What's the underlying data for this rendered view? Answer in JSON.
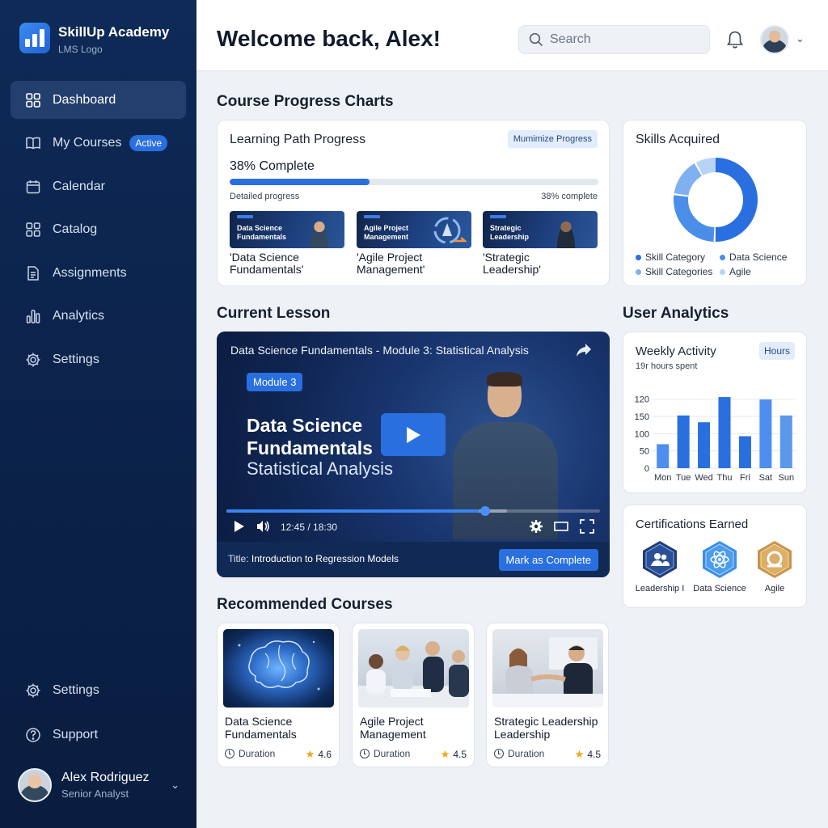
{
  "brand": {
    "title": "SkillUp Academy",
    "subtitle": "LMS Logo"
  },
  "sidebar": {
    "items": [
      {
        "label": "Dashboard",
        "icon": "grid-icon",
        "active": true
      },
      {
        "label": "My Courses",
        "icon": "book-icon",
        "badge": "Active"
      },
      {
        "label": "Calendar",
        "icon": "calendar-icon"
      },
      {
        "label": "Catalog",
        "icon": "grid-icon"
      },
      {
        "label": "Assignments",
        "icon": "document-icon"
      },
      {
        "label": "Analytics",
        "icon": "bar-chart-icon"
      },
      {
        "label": "Settings",
        "icon": "gear-icon"
      }
    ],
    "bottom": [
      {
        "label": "Settings",
        "icon": "gear-icon"
      },
      {
        "label": "Support",
        "icon": "help-icon"
      }
    ],
    "user": {
      "name": "Alex Rodriguez",
      "role": "Senior Analyst"
    }
  },
  "header": {
    "welcome": "Welcome back, Alex!",
    "search_placeholder": "Search"
  },
  "sections": {
    "progress": "Course Progress Charts",
    "lesson": "Current Lesson",
    "analytics": "User Analytics",
    "recommended": "Recommended Courses"
  },
  "learning_path": {
    "title": "Learning Path Progress",
    "button": "Mumimize Progress",
    "percent_label": "38% Complete",
    "progress": 0.38,
    "detail_left": "Detailed progress",
    "detail_right": "38% complete",
    "courses": [
      {
        "thumb": "Data Science Fundamentals",
        "caption": "'Data Science Fundamentals'"
      },
      {
        "thumb": "Agile Project Management",
        "caption": "'Agile Project Management'"
      },
      {
        "thumb": "Strategic Leadership",
        "caption": "'Strategic Leadership'"
      }
    ]
  },
  "skills": {
    "title": "Skills Acquired",
    "legend": [
      "Skill Category",
      "Data Science",
      "Skill Categories",
      "Agile"
    ],
    "colors": [
      "#2a6fe0",
      "#4a8ee8",
      "#7fb0f0",
      "#b7d3f6"
    ]
  },
  "video": {
    "title": "Data Science Fundamentals - Module 3: Statistical Analysis",
    "module_tag": "Module 3",
    "heading_1": "Data Science",
    "heading_2": "Fundamentals",
    "heading_3": "Statistical Analysis",
    "time": "12:45 / 18:30",
    "played_fraction": 0.69,
    "footer_prefix": "Title:",
    "footer_title": "Introduction to Regression Models",
    "mark_button": "Mark as Complete"
  },
  "weekly": {
    "title": "Weekly Activity",
    "subtitle": "19r hours spent",
    "button": "Hours"
  },
  "chart_data": {
    "type": "bar",
    "categories": [
      "Mon",
      "Tue",
      "Wed",
      "Thu",
      "Fri",
      "Sat",
      "Sun"
    ],
    "values": [
      60,
      132,
      115,
      178,
      80,
      172,
      132
    ],
    "y_tick_labels": [
      "0",
      "50",
      "100",
      "150",
      "120"
    ],
    "ylim": [
      0,
      200
    ],
    "grid": true,
    "colors": [
      "#4d8ef0",
      "#2a6fe0",
      "#2a6fe0",
      "#2a6fe0",
      "#2a6fe0",
      "#4d8ef0",
      "#5b98ec"
    ]
  },
  "certifications": {
    "title": "Certifications Earned",
    "items": [
      {
        "label": "Leadership I",
        "icon": "team-icon",
        "color": "#1f3d78"
      },
      {
        "label": "Data Science",
        "icon": "atom-icon",
        "color": "#3d8fe6"
      },
      {
        "label": "Agile",
        "icon": "agile-icon",
        "color": "#c8944a"
      }
    ]
  },
  "recommended": [
    {
      "title_1": "Data Science",
      "title_2": "Fundamentals",
      "duration": "Duration",
      "rating": "4.6"
    },
    {
      "title_1": "Agile Project",
      "title_2": "Management",
      "duration": "Duration",
      "rating": "4.5"
    },
    {
      "title_1": "Strategic Leadership",
      "title_2": "Leadership",
      "duration": "Duration",
      "rating": "4.5"
    }
  ]
}
